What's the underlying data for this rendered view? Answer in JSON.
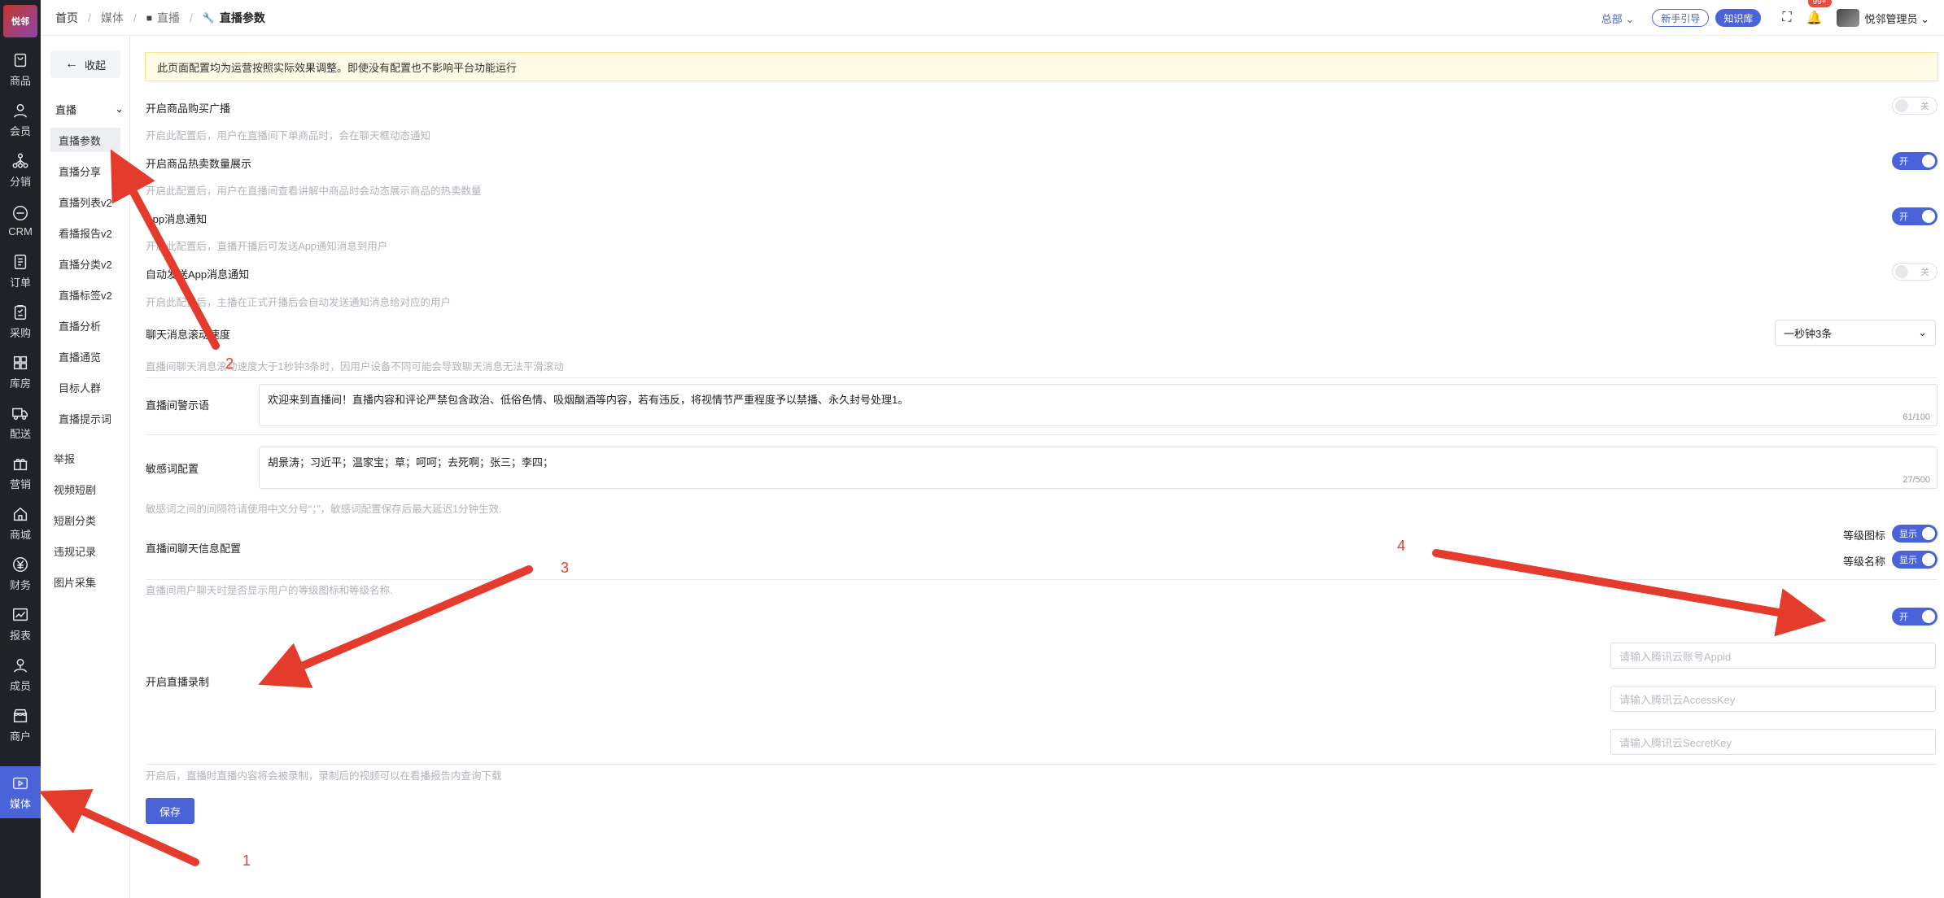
{
  "rail": {
    "logo_text": "悦邻",
    "items": [
      {
        "label": "商品",
        "icon": "product-icon"
      },
      {
        "label": "会员",
        "icon": "member-icon"
      },
      {
        "label": "分销",
        "icon": "distribution-icon"
      },
      {
        "label": "CRM",
        "icon": "crm-icon"
      },
      {
        "label": "订单",
        "icon": "order-icon"
      },
      {
        "label": "采购",
        "icon": "purchase-icon"
      },
      {
        "label": "库房",
        "icon": "warehouse-icon"
      },
      {
        "label": "配送",
        "icon": "delivery-icon"
      },
      {
        "label": "营销",
        "icon": "gift-icon"
      },
      {
        "label": "商城",
        "icon": "store-icon"
      },
      {
        "label": "财务",
        "icon": "finance-icon"
      },
      {
        "label": "报表",
        "icon": "chart-icon"
      },
      {
        "label": "成员",
        "icon": "team-icon"
      },
      {
        "label": "商户",
        "icon": "merchant-icon"
      },
      {
        "label": "媒体",
        "icon": "media-icon"
      }
    ]
  },
  "submenu": {
    "collapse_label": "收起",
    "group": "直播",
    "items": [
      "直播参数",
      "直播分享",
      "直播列表v2",
      "看播报告v2",
      "直播分类v2",
      "直播标签v2",
      "直播分析",
      "直播通览",
      "目标人群",
      "直播提示词"
    ],
    "root_items": [
      "举报",
      "视频短剧",
      "短剧分类",
      "违规记录",
      "图片采集"
    ]
  },
  "header": {
    "crumbs": [
      "首页",
      "媒体",
      "直播",
      "直播参数"
    ],
    "region": "总部",
    "guide": "新手引导",
    "kb": "知识库",
    "badge": "99+",
    "user": "悦邻管理员"
  },
  "notice": "此页面配置均为运营按照实际效果调整。即使没有配置也不影响平台功能运行",
  "settings": {
    "purchase_broadcast": {
      "label": "开启商品购买广播",
      "help": "开启此配置后，用户在直播间下单商品时，会在聊天框动态通知",
      "state": "关"
    },
    "hot_sales": {
      "label": "开启商品热卖数量展示",
      "help": "开启此配置后，用户在直播间查看讲解中商品时会动态展示商品的热卖数量",
      "state": "开"
    },
    "app_notify": {
      "label": "App消息通知",
      "help": "开启此配置后，直播开播后可发送App通知消息到用户",
      "state": "开"
    },
    "auto_app_notify": {
      "label": "自动发送App消息通知",
      "help": "开启此配置后，主播在正式开播后会自动发送通知消息给对应的用户",
      "state": "关"
    },
    "chat_speed": {
      "label": "聊天消息滚动速度",
      "help": "直播间聊天消息滚动速度大于1秒钟3条时，因用户设备不同可能会导致聊天消息无法平滑滚动",
      "value": "一秒钟3条"
    },
    "warning": {
      "label": "直播间警示语",
      "value": "欢迎来到直播间！直播内容和评论严禁包含政治、低俗色情、吸烟酗酒等内容，若有违反，将视情节严重程度予以禁播、永久封号处理1。",
      "count": "61/100"
    },
    "sensitive": {
      "label": "敏感词配置",
      "value": "胡景涛；习近平；温家宝；草；呵呵；去死啊；张三；李四；",
      "count": "27/500",
      "help": "敏感词之间的间隔符请使用中文分号“；”，敏感词配置保存后最大延迟1分钟生效."
    },
    "chat_info": {
      "label": "直播间聊天信息配置",
      "help": "直播间用户聊天时是否显示用户的等级图标和等级名称.",
      "level_icon": "等级图标",
      "level_name": "等级名称",
      "show": "显示"
    },
    "recording": {
      "label": "开启直播录制",
      "state": "开",
      "help": "开启后，直播时直播内容将会被录制，录制后的视频可以在看播报告内查询下载",
      "appid_ph": "请输入腾讯云账号Appid",
      "access_ph": "请输入腾讯云AccessKey",
      "secret_ph": "请输入腾讯云SecretKey"
    }
  },
  "save_label": "保存",
  "annotations": [
    "1",
    "2",
    "3",
    "4"
  ],
  "colors": {
    "accent": "#4a63d8",
    "rail": "#1f2229",
    "arrow": "#e53b2c"
  }
}
